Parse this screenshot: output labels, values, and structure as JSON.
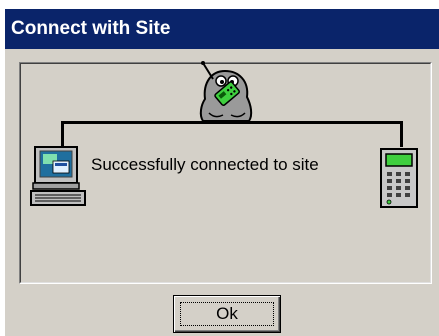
{
  "window": {
    "title": "Connect with Site"
  },
  "status": {
    "message": "Successfully connected to site"
  },
  "buttons": {
    "ok_label": "Ok"
  },
  "icons": {
    "center": "mascot-with-phone-icon",
    "left": "computer-icon",
    "right": "site-terminal-icon"
  },
  "colors": {
    "titlebar": "#0a246a",
    "dialog_face": "#d4d0c8",
    "phone_green": "#3fcf3f"
  }
}
